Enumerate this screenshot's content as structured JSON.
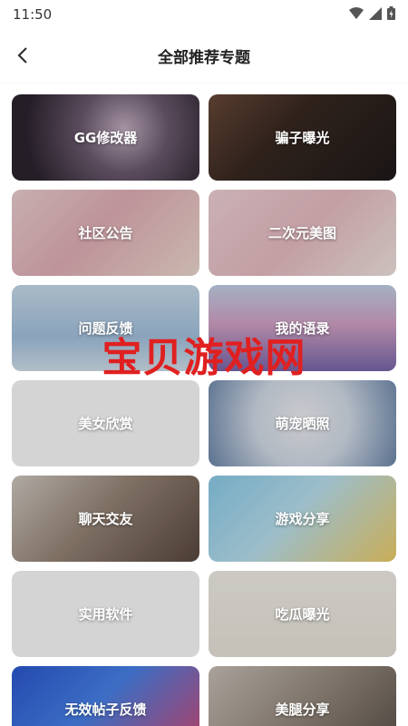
{
  "status": {
    "time": "11:50"
  },
  "header": {
    "title": "全部推荐专题"
  },
  "cards": [
    {
      "label": "GG修改器"
    },
    {
      "label": "骗子曝光"
    },
    {
      "label": "社区公告"
    },
    {
      "label": "二次元美图"
    },
    {
      "label": "问题反馈"
    },
    {
      "label": "我的语录"
    },
    {
      "label": "美女欣赏"
    },
    {
      "label": "萌宠晒照"
    },
    {
      "label": "聊天交友"
    },
    {
      "label": "游戏分享"
    },
    {
      "label": "实用软件"
    },
    {
      "label": "吃瓜曝光"
    },
    {
      "label": "无效帖子反馈"
    },
    {
      "label": "美腿分享"
    }
  ],
  "watermark": "宝贝游戏网"
}
